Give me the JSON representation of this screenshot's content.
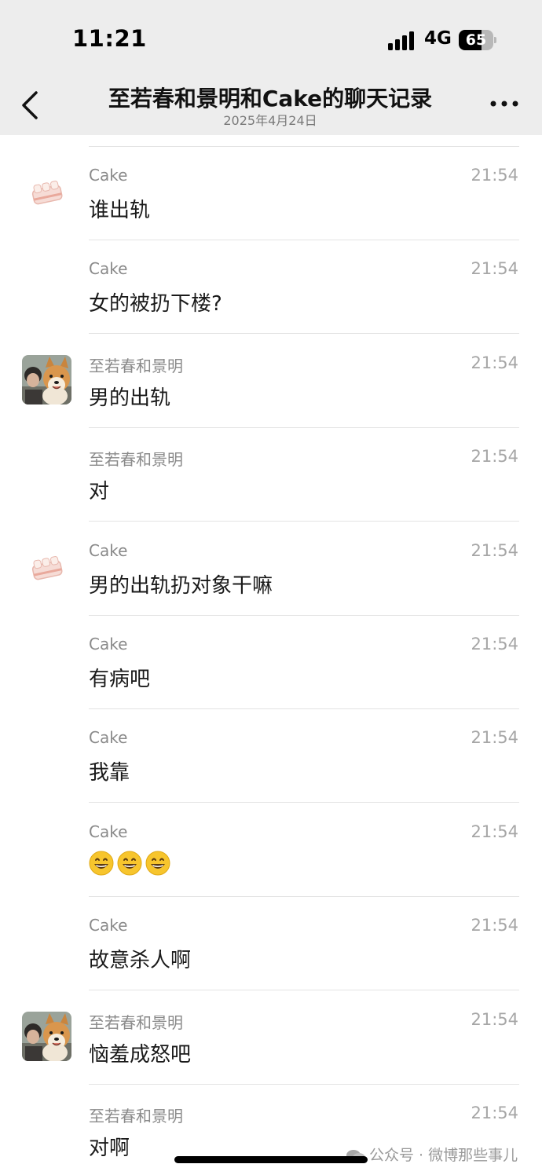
{
  "status_bar": {
    "time": "11:21",
    "network": "4G",
    "battery": "65",
    "battery_level": 0.65
  },
  "header": {
    "title": "至若春和景明和Cake的聊天记录",
    "date": "2025年4月24日"
  },
  "colors": {
    "header_bg": "#ededed",
    "divider": "#e3e3e3",
    "sender": "#8a8a8a",
    "time": "#a6a6a6"
  },
  "messages": [
    {
      "sender": "Cake",
      "time": "21:54",
      "text": "谁出轨",
      "avatar": "cake-avatar"
    },
    {
      "sender": "Cake",
      "time": "21:54",
      "text": "女的被扔下楼?"
    },
    {
      "sender": "至若春和景明",
      "time": "21:54",
      "text": "男的出轨",
      "avatar": "dog-avatar"
    },
    {
      "sender": "至若春和景明",
      "time": "21:54",
      "text": "对"
    },
    {
      "sender": "Cake",
      "time": "21:54",
      "text": "男的出轨扔对象干嘛",
      "avatar": "cake-avatar"
    },
    {
      "sender": "Cake",
      "time": "21:54",
      "text": "有病吧"
    },
    {
      "sender": "Cake",
      "time": "21:54",
      "text": "我靠"
    },
    {
      "sender": "Cake",
      "time": "21:54",
      "text": "",
      "emojis": [
        "grinning-face-emoji",
        "grinning-face-emoji",
        "grinning-face-emoji"
      ]
    },
    {
      "sender": "Cake",
      "time": "21:54",
      "text": "故意杀人啊"
    },
    {
      "sender": "至若春和景明",
      "time": "21:54",
      "text": "恼羞成怒吧",
      "avatar": "dog-avatar"
    },
    {
      "sender": "至若春和景明",
      "time": "21:54",
      "text": "对啊"
    }
  ],
  "watermark": "公众号 · 微博那些事儿"
}
